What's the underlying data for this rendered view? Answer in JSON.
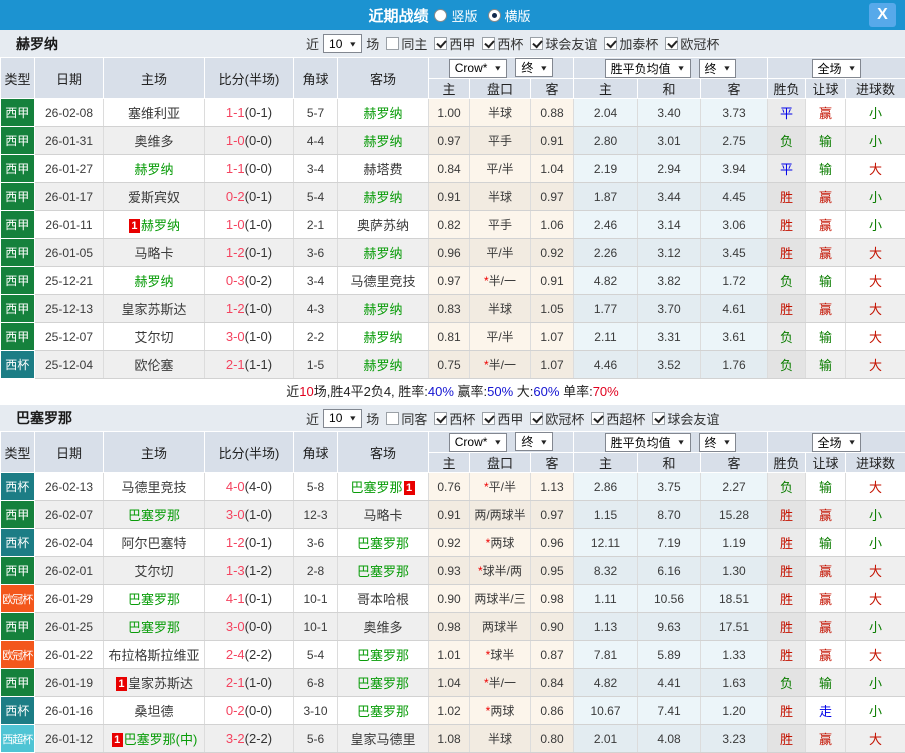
{
  "titlebar": {
    "title": "近期战绩",
    "radio_vertical": "竖版",
    "radio_horizontal": "横版",
    "selected": "horizontal",
    "close": "X"
  },
  "labels": {
    "near": "近",
    "games": "场"
  },
  "hdr": {
    "cols": [
      "类型",
      "日期",
      "主场",
      "比分(半场)",
      "角球",
      "客场"
    ],
    "sub": [
      "主",
      "盘口",
      "客",
      "主",
      "和",
      "客",
      "胜负",
      "让球",
      "进球数"
    ],
    "dd": {
      "crow": "Crow*",
      "end1": "终",
      "avg": "胜平负均值",
      "end2": "终",
      "scope": "全场"
    }
  },
  "sections": [
    {
      "team": "赫罗纳",
      "filter": {
        "count": "10",
        "same": "同主",
        "same_checked": false,
        "leagues": [
          {
            "label": "西甲",
            "checked": true
          },
          {
            "label": "西杯",
            "checked": true
          },
          {
            "label": "球会友谊",
            "checked": true
          },
          {
            "label": "加泰杯",
            "checked": true
          },
          {
            "label": "欧冠杯",
            "checked": true
          }
        ]
      },
      "rows": [
        {
          "type": "西甲",
          "tc": "liga",
          "date": "26-02-08",
          "home": {
            "t": "塞维利亚",
            "g": false,
            "b": "",
            "bp": ""
          },
          "score": "1-1",
          "half": "(0-1)",
          "corner": "5-7",
          "away": {
            "t": "赫罗纳",
            "g": true,
            "b": "",
            "bp": ""
          },
          "o1": "1.00",
          "star": "",
          "hc": "半球",
          "o3": "0.88",
          "a1": "2.04",
          "a2": "3.40",
          "a3": "3.73",
          "r1": {
            "t": "平",
            "c": "B"
          },
          "r2": {
            "t": "赢",
            "c": "R"
          },
          "r3": {
            "t": "小",
            "c": "G"
          }
        },
        {
          "type": "西甲",
          "tc": "liga",
          "date": "26-01-31",
          "home": {
            "t": "奥维多",
            "g": false,
            "b": "",
            "bp": ""
          },
          "score": "1-0",
          "half": "(0-0)",
          "corner": "4-4",
          "away": {
            "t": "赫罗纳",
            "g": true,
            "b": "",
            "bp": ""
          },
          "o1": "0.97",
          "star": "",
          "hc": "平手",
          "o3": "0.91",
          "a1": "2.80",
          "a2": "3.01",
          "a3": "2.75",
          "r1": {
            "t": "负",
            "c": "G"
          },
          "r2": {
            "t": "输",
            "c": "G"
          },
          "r3": {
            "t": "小",
            "c": "G"
          }
        },
        {
          "type": "西甲",
          "tc": "liga",
          "date": "26-01-27",
          "home": {
            "t": "赫罗纳",
            "g": true,
            "b": "",
            "bp": ""
          },
          "score": "1-1",
          "half": "(0-0)",
          "corner": "3-4",
          "away": {
            "t": "赫塔费",
            "g": false,
            "b": "",
            "bp": ""
          },
          "o1": "0.84",
          "star": "",
          "hc": "平/半",
          "o3": "1.04",
          "a1": "2.19",
          "a2": "2.94",
          "a3": "3.94",
          "r1": {
            "t": "平",
            "c": "B"
          },
          "r2": {
            "t": "输",
            "c": "G"
          },
          "r3": {
            "t": "大",
            "c": "R"
          }
        },
        {
          "type": "西甲",
          "tc": "liga",
          "date": "26-01-17",
          "home": {
            "t": "爱斯宾奴",
            "g": false,
            "b": "",
            "bp": ""
          },
          "score": "0-2",
          "half": "(0-1)",
          "corner": "5-4",
          "away": {
            "t": "赫罗纳",
            "g": true,
            "b": "",
            "bp": ""
          },
          "o1": "0.91",
          "star": "",
          "hc": "半球",
          "o3": "0.97",
          "a1": "1.87",
          "a2": "3.44",
          "a3": "4.45",
          "r1": {
            "t": "胜",
            "c": "R"
          },
          "r2": {
            "t": "赢",
            "c": "R"
          },
          "r3": {
            "t": "小",
            "c": "G"
          }
        },
        {
          "type": "西甲",
          "tc": "liga",
          "date": "26-01-11",
          "home": {
            "t": "赫罗纳",
            "g": true,
            "b": "1",
            "bp": "l"
          },
          "score": "1-0",
          "half": "(1-0)",
          "corner": "2-1",
          "away": {
            "t": "奥萨苏纳",
            "g": false,
            "b": "",
            "bp": ""
          },
          "o1": "0.82",
          "star": "",
          "hc": "平手",
          "o3": "1.06",
          "a1": "2.46",
          "a2": "3.14",
          "a3": "3.06",
          "r1": {
            "t": "胜",
            "c": "R"
          },
          "r2": {
            "t": "赢",
            "c": "R"
          },
          "r3": {
            "t": "小",
            "c": "G"
          }
        },
        {
          "type": "西甲",
          "tc": "liga",
          "date": "26-01-05",
          "home": {
            "t": "马略卡",
            "g": false,
            "b": "",
            "bp": ""
          },
          "score": "1-2",
          "half": "(0-1)",
          "corner": "3-6",
          "away": {
            "t": "赫罗纳",
            "g": true,
            "b": "",
            "bp": ""
          },
          "o1": "0.96",
          "star": "",
          "hc": "平/半",
          "o3": "0.92",
          "a1": "2.26",
          "a2": "3.12",
          "a3": "3.45",
          "r1": {
            "t": "胜",
            "c": "R"
          },
          "r2": {
            "t": "赢",
            "c": "R"
          },
          "r3": {
            "t": "大",
            "c": "R"
          }
        },
        {
          "type": "西甲",
          "tc": "liga",
          "date": "25-12-21",
          "home": {
            "t": "赫罗纳",
            "g": true,
            "b": "",
            "bp": ""
          },
          "score": "0-3",
          "half": "(0-2)",
          "corner": "3-4",
          "away": {
            "t": "马德里竞技",
            "g": false,
            "b": "",
            "bp": ""
          },
          "o1": "0.97",
          "star": "*",
          "hc": "半/一",
          "o3": "0.91",
          "a1": "4.82",
          "a2": "3.82",
          "a3": "1.72",
          "r1": {
            "t": "负",
            "c": "G"
          },
          "r2": {
            "t": "输",
            "c": "G"
          },
          "r3": {
            "t": "大",
            "c": "R"
          }
        },
        {
          "type": "西甲",
          "tc": "liga",
          "date": "25-12-13",
          "home": {
            "t": "皇家苏斯达",
            "g": false,
            "b": "",
            "bp": ""
          },
          "score": "1-2",
          "half": "(1-0)",
          "corner": "4-3",
          "away": {
            "t": "赫罗纳",
            "g": true,
            "b": "",
            "bp": ""
          },
          "o1": "0.83",
          "star": "",
          "hc": "半球",
          "o3": "1.05",
          "a1": "1.77",
          "a2": "3.70",
          "a3": "4.61",
          "r1": {
            "t": "胜",
            "c": "R"
          },
          "r2": {
            "t": "赢",
            "c": "R"
          },
          "r3": {
            "t": "大",
            "c": "R"
          }
        },
        {
          "type": "西甲",
          "tc": "liga",
          "date": "25-12-07",
          "home": {
            "t": "艾尔切",
            "g": false,
            "b": "",
            "bp": ""
          },
          "score": "3-0",
          "half": "(1-0)",
          "corner": "2-2",
          "away": {
            "t": "赫罗纳",
            "g": true,
            "b": "",
            "bp": ""
          },
          "o1": "0.81",
          "star": "",
          "hc": "平/半",
          "o3": "1.07",
          "a1": "2.11",
          "a2": "3.31",
          "a3": "3.61",
          "r1": {
            "t": "负",
            "c": "G"
          },
          "r2": {
            "t": "输",
            "c": "G"
          },
          "r3": {
            "t": "大",
            "c": "R"
          }
        },
        {
          "type": "西杯",
          "tc": "copa",
          "date": "25-12-04",
          "home": {
            "t": "欧伦塞",
            "g": false,
            "b": "",
            "bp": ""
          },
          "score": "2-1",
          "half": "(1-1)",
          "corner": "1-5",
          "away": {
            "t": "赫罗纳",
            "g": true,
            "b": "",
            "bp": ""
          },
          "o1": "0.75",
          "star": "*",
          "hc": "半/一",
          "o3": "1.07",
          "a1": "4.46",
          "a2": "3.52",
          "a3": "1.76",
          "r1": {
            "t": "负",
            "c": "G"
          },
          "r2": {
            "t": "输",
            "c": "G"
          },
          "r3": {
            "t": "大",
            "c": "R"
          }
        }
      ],
      "summary": [
        {
          "t": "近",
          "c": "k"
        },
        {
          "t": "10",
          "c": "r"
        },
        {
          "t": "场,胜4平2负4, 胜率:",
          "c": "k"
        },
        {
          "t": "40%",
          "c": "b"
        },
        {
          "t": " 赢率:",
          "c": "k"
        },
        {
          "t": "50%",
          "c": "b"
        },
        {
          "t": " 大:",
          "c": "k"
        },
        {
          "t": "60%",
          "c": "b"
        },
        {
          "t": " 单率:",
          "c": "k"
        },
        {
          "t": "70%",
          "c": "r"
        }
      ]
    },
    {
      "team": "巴塞罗那",
      "filter": {
        "count": "10",
        "same": "同客",
        "same_checked": false,
        "leagues": [
          {
            "label": "西杯",
            "checked": true
          },
          {
            "label": "西甲",
            "checked": true
          },
          {
            "label": "欧冠杯",
            "checked": true
          },
          {
            "label": "西超杯",
            "checked": true
          },
          {
            "label": "球会友谊",
            "checked": true
          }
        ]
      },
      "rows": [
        {
          "type": "西杯",
          "tc": "copa",
          "date": "26-02-13",
          "home": {
            "t": "马德里竞技",
            "g": false,
            "b": "",
            "bp": ""
          },
          "score": "4-0",
          "half": "(4-0)",
          "corner": "5-8",
          "away": {
            "t": "巴塞罗那",
            "g": true,
            "b": "1",
            "bp": "r"
          },
          "o1": "0.76",
          "star": "*",
          "hc": "平/半",
          "o3": "1.13",
          "a1": "2.86",
          "a2": "3.75",
          "a3": "2.27",
          "r1": {
            "t": "负",
            "c": "G"
          },
          "r2": {
            "t": "输",
            "c": "G"
          },
          "r3": {
            "t": "大",
            "c": "R"
          }
        },
        {
          "type": "西甲",
          "tc": "liga",
          "date": "26-02-07",
          "home": {
            "t": "巴塞罗那",
            "g": true,
            "b": "",
            "bp": ""
          },
          "score": "3-0",
          "half": "(1-0)",
          "corner": "12-3",
          "away": {
            "t": "马略卡",
            "g": false,
            "b": "",
            "bp": ""
          },
          "o1": "0.91",
          "star": "",
          "hc": "两/两球半",
          "o3": "0.97",
          "a1": "1.15",
          "a2": "8.70",
          "a3": "15.28",
          "r1": {
            "t": "胜",
            "c": "R"
          },
          "r2": {
            "t": "赢",
            "c": "R"
          },
          "r3": {
            "t": "小",
            "c": "G"
          }
        },
        {
          "type": "西杯",
          "tc": "copa",
          "date": "26-02-04",
          "home": {
            "t": "阿尔巴塞特",
            "g": false,
            "b": "",
            "bp": ""
          },
          "score": "1-2",
          "half": "(0-1)",
          "corner": "3-6",
          "away": {
            "t": "巴塞罗那",
            "g": true,
            "b": "",
            "bp": ""
          },
          "o1": "0.92",
          "star": "*",
          "hc": "两球",
          "o3": "0.96",
          "a1": "12.11",
          "a2": "7.19",
          "a3": "1.19",
          "r1": {
            "t": "胜",
            "c": "R"
          },
          "r2": {
            "t": "输",
            "c": "G"
          },
          "r3": {
            "t": "小",
            "c": "G"
          }
        },
        {
          "type": "西甲",
          "tc": "liga",
          "date": "26-02-01",
          "home": {
            "t": "艾尔切",
            "g": false,
            "b": "",
            "bp": ""
          },
          "score": "1-3",
          "half": "(1-2)",
          "corner": "2-8",
          "away": {
            "t": "巴塞罗那",
            "g": true,
            "b": "",
            "bp": ""
          },
          "o1": "0.93",
          "star": "*",
          "hc": "球半/两",
          "o3": "0.95",
          "a1": "8.32",
          "a2": "6.16",
          "a3": "1.30",
          "r1": {
            "t": "胜",
            "c": "R"
          },
          "r2": {
            "t": "赢",
            "c": "R"
          },
          "r3": {
            "t": "大",
            "c": "R"
          }
        },
        {
          "type": "欧冠杯",
          "tc": "ucl",
          "date": "26-01-29",
          "home": {
            "t": "巴塞罗那",
            "g": true,
            "b": "",
            "bp": ""
          },
          "score": "4-1",
          "half": "(0-1)",
          "corner": "10-1",
          "away": {
            "t": "哥本哈根",
            "g": false,
            "b": "",
            "bp": ""
          },
          "o1": "0.90",
          "star": "",
          "hc": "两球半/三",
          "o3": "0.98",
          "a1": "1.11",
          "a2": "10.56",
          "a3": "18.51",
          "r1": {
            "t": "胜",
            "c": "R"
          },
          "r2": {
            "t": "赢",
            "c": "R"
          },
          "r3": {
            "t": "大",
            "c": "R"
          }
        },
        {
          "type": "西甲",
          "tc": "liga",
          "date": "26-01-25",
          "home": {
            "t": "巴塞罗那",
            "g": true,
            "b": "",
            "bp": ""
          },
          "score": "3-0",
          "half": "(0-0)",
          "corner": "10-1",
          "away": {
            "t": "奥维多",
            "g": false,
            "b": "",
            "bp": ""
          },
          "o1": "0.98",
          "star": "",
          "hc": "两球半",
          "o3": "0.90",
          "a1": "1.13",
          "a2": "9.63",
          "a3": "17.51",
          "r1": {
            "t": "胜",
            "c": "R"
          },
          "r2": {
            "t": "赢",
            "c": "R"
          },
          "r3": {
            "t": "小",
            "c": "G"
          }
        },
        {
          "type": "欧冠杯",
          "tc": "ucl",
          "date": "26-01-22",
          "home": {
            "t": "布拉格斯拉维亚",
            "g": false,
            "b": "",
            "bp": ""
          },
          "score": "2-4",
          "half": "(2-2)",
          "corner": "5-4",
          "away": {
            "t": "巴塞罗那",
            "g": true,
            "b": "",
            "bp": ""
          },
          "o1": "1.01",
          "star": "*",
          "hc": "球半",
          "o3": "0.87",
          "a1": "7.81",
          "a2": "5.89",
          "a3": "1.33",
          "r1": {
            "t": "胜",
            "c": "R"
          },
          "r2": {
            "t": "赢",
            "c": "R"
          },
          "r3": {
            "t": "大",
            "c": "R"
          }
        },
        {
          "type": "西甲",
          "tc": "liga",
          "date": "26-01-19",
          "home": {
            "t": "皇家苏斯达",
            "g": false,
            "b": "1",
            "bp": "l"
          },
          "score": "2-1",
          "half": "(1-0)",
          "corner": "6-8",
          "away": {
            "t": "巴塞罗那",
            "g": true,
            "b": "",
            "bp": ""
          },
          "o1": "1.04",
          "star": "*",
          "hc": "半/一",
          "o3": "0.84",
          "a1": "4.82",
          "a2": "4.41",
          "a3": "1.63",
          "r1": {
            "t": "负",
            "c": "G"
          },
          "r2": {
            "t": "输",
            "c": "G"
          },
          "r3": {
            "t": "小",
            "c": "G"
          }
        },
        {
          "type": "西杯",
          "tc": "copa",
          "date": "26-01-16",
          "home": {
            "t": "桑坦德",
            "g": false,
            "b": "",
            "bp": ""
          },
          "score": "0-2",
          "half": "(0-0)",
          "corner": "3-10",
          "away": {
            "t": "巴塞罗那",
            "g": true,
            "b": "",
            "bp": ""
          },
          "o1": "1.02",
          "star": "*",
          "hc": "两球",
          "o3": "0.86",
          "a1": "10.67",
          "a2": "7.41",
          "a3": "1.20",
          "r1": {
            "t": "胜",
            "c": "R"
          },
          "r2": {
            "t": "走",
            "c": "B"
          },
          "r3": {
            "t": "小",
            "c": "G"
          }
        },
        {
          "type": "西超杯",
          "tc": "sup",
          "date": "26-01-12",
          "home": {
            "t": "巴塞罗那(中)",
            "g": true,
            "b": "1",
            "bp": "l"
          },
          "score": "3-2",
          "half": "(2-2)",
          "corner": "5-6",
          "away": {
            "t": "皇家马德里",
            "g": false,
            "b": "",
            "bp": ""
          },
          "o1": "1.08",
          "star": "",
          "hc": "半球",
          "o3": "0.80",
          "a1": "2.01",
          "a2": "4.08",
          "a3": "3.23",
          "r1": {
            "t": "胜",
            "c": "R"
          },
          "r2": {
            "t": "赢",
            "c": "R"
          },
          "r3": {
            "t": "大",
            "c": "R"
          }
        }
      ],
      "summary": null
    }
  ]
}
